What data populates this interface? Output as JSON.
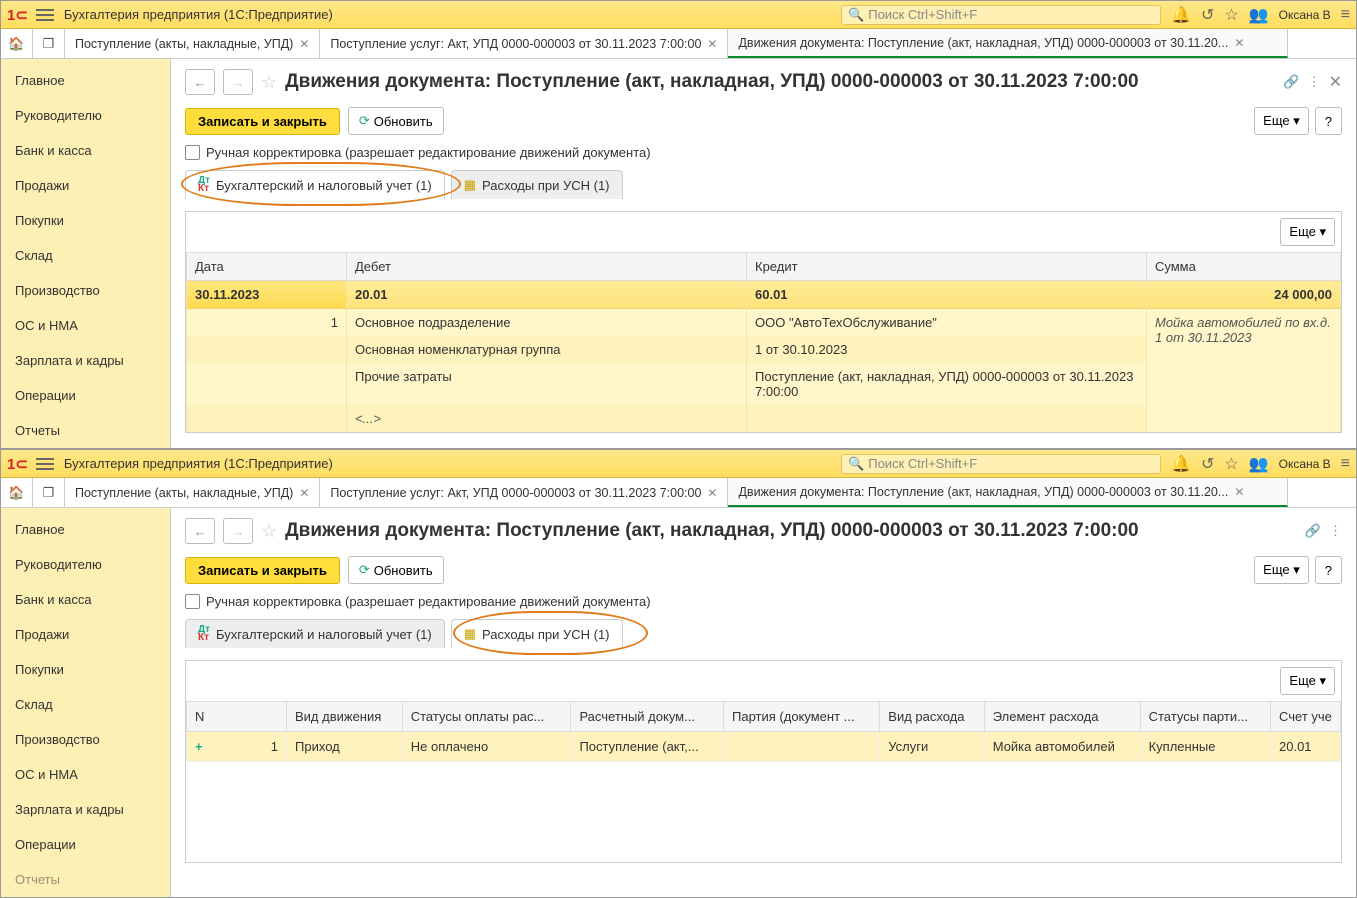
{
  "app": {
    "title": "Бухгалтерия предприятия  (1С:Предприятие)",
    "search_placeholder": "Поиск Ctrl+Shift+F",
    "user": "Оксана В"
  },
  "apptabs": {
    "t1": "Поступление (акты, накладные, УПД)",
    "t2": "Поступление услуг: Акт, УПД 0000-000003 от 30.11.2023 7:00:00",
    "t3": "Движения документа: Поступление (акт, накладная, УПД) 0000-000003 от 30.11.20..."
  },
  "sidebar": {
    "i0": "Главное",
    "i1": "Руководителю",
    "i2": "Банк и касса",
    "i3": "Продажи",
    "i4": "Покупки",
    "i5": "Склад",
    "i6": "Производство",
    "i7": "ОС и НМА",
    "i8": "Зарплата и кадры",
    "i9": "Операции",
    "i10": "Отчеты"
  },
  "doc": {
    "title": "Движения документа: Поступление (акт, накладная, УПД) 0000-000003 от 30.11.2023 7:00:00",
    "save_close": "Записать и закрыть",
    "refresh": "Обновить",
    "more": "Еще",
    "help": "?",
    "manual_edit": "Ручная корректировка (разрешает редактирование движений документа)",
    "tab1": "Бухгалтерский и налоговый учет (1)",
    "tab2": "Расходы при УСН (1)"
  },
  "grid1": {
    "h_date": "Дата",
    "h_debit": "Дебет",
    "h_credit": "Кредит",
    "h_sum": "Сумма",
    "r_date": "30.11.2023",
    "r_debit": "20.01",
    "r_credit": "60.01",
    "r_sum": "24 000,00",
    "r_num": "1",
    "d1_debit": "Основное подразделение",
    "d1_credit": "ООО \"АвтоТехОбслуживание\"",
    "d1_sum": "Мойка автомобилей по вх.д. 1 от 30.11.2023",
    "d2_debit": "Основная номенклатурная группа",
    "d2_credit": "1 от 30.10.2023",
    "d3_debit": "Прочие затраты",
    "d3_credit": "Поступление (акт, накладная, УПД) 0000-000003 от 30.11.2023 7:00:00",
    "d4_debit": "<...>"
  },
  "grid2": {
    "h_n": "N",
    "h_type": "Вид движения",
    "h_pay": "Статусы оплаты рас...",
    "h_calc": "Расчетный докум...",
    "h_party": "Партия (документ ...",
    "h_exp": "Вид расхода",
    "h_elem": "Элемент расхода",
    "h_partst": "Статусы парти...",
    "h_acc": "Счет уче",
    "r_n": "1",
    "r_type": "Приход",
    "r_pay": "Не оплачено",
    "r_calc": "Поступление (акт,...",
    "r_party": "",
    "r_exp": "Услуги",
    "r_elem": "Мойка автомобилей",
    "r_partst": "Купленные",
    "r_acc": "20.01"
  }
}
